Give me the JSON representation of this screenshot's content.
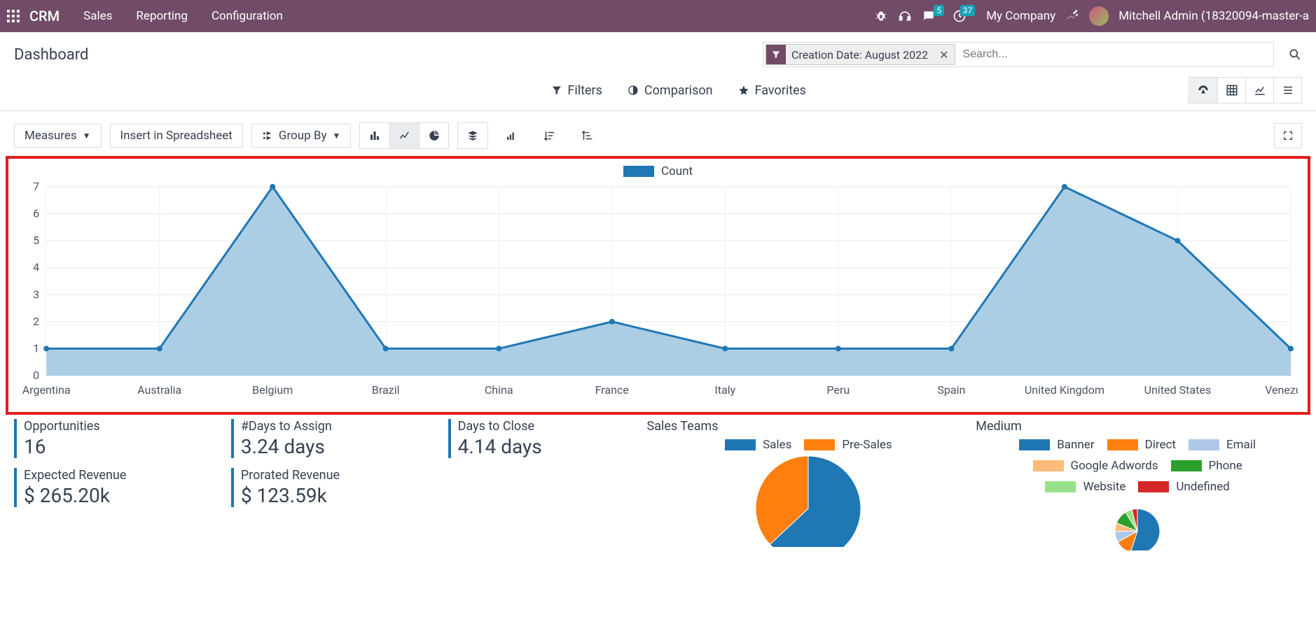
{
  "nav": {
    "brand": "CRM",
    "links": [
      "Sales",
      "Reporting",
      "Configuration"
    ],
    "company": "My Company",
    "username": "Mitchell Admin (18320094-master-a",
    "messages_badge": "5",
    "activities_badge": "37"
  },
  "header": {
    "title": "Dashboard",
    "chip_label": "Creation Date: August 2022",
    "search_placeholder": "Search..."
  },
  "filterbar": {
    "filters": "Filters",
    "comparison": "Comparison",
    "favorites": "Favorites"
  },
  "toolbar": {
    "measures": "Measures",
    "insert": "Insert in Spreadsheet",
    "groupby": "Group By"
  },
  "chart_data": {
    "type": "area",
    "series_name": "Count",
    "categories": [
      "Argentina",
      "Australia",
      "Belgium",
      "Brazil",
      "China",
      "France",
      "Italy",
      "Peru",
      "Spain",
      "United Kingdom",
      "United States",
      "Venezuela"
    ],
    "values": [
      1,
      1,
      7,
      1,
      1,
      2,
      1,
      1,
      1,
      7,
      5,
      1
    ],
    "ylim": [
      0,
      7
    ],
    "yticks": [
      0,
      1,
      2,
      3,
      4,
      5,
      6,
      7
    ],
    "xlabel": "",
    "ylabel": ""
  },
  "kpis": {
    "opportunities": {
      "label": "Opportunities",
      "value": "16"
    },
    "days_assign": {
      "label": "#Days to Assign",
      "value": "3.24 days"
    },
    "days_close": {
      "label": "Days to Close",
      "value": "4.14 days"
    },
    "expected_rev": {
      "label": "Expected Revenue",
      "value": "$ 265.20k"
    },
    "prorated_rev": {
      "label": "Prorated Revenue",
      "value": "$ 123.59k"
    }
  },
  "sales_teams": {
    "title": "Sales Teams",
    "legend": [
      {
        "name": "Sales",
        "color": "#1f77b4"
      },
      {
        "name": "Pre-Sales",
        "color": "#ff7f0e"
      }
    ],
    "slices": [
      {
        "name": "Sales",
        "value": 63,
        "color": "#1f77b4"
      },
      {
        "name": "Pre-Sales",
        "value": 37,
        "color": "#ff7f0e"
      }
    ]
  },
  "medium": {
    "title": "Medium",
    "legend": [
      {
        "name": "Banner",
        "color": "#1f77b4"
      },
      {
        "name": "Direct",
        "color": "#ff7f0e"
      },
      {
        "name": "Email",
        "color": "#aec7e8"
      },
      {
        "name": "Google Adwords",
        "color": "#ffbb78"
      },
      {
        "name": "Phone",
        "color": "#2ca02c"
      },
      {
        "name": "Website",
        "color": "#98df8a"
      },
      {
        "name": "Undefined",
        "color": "#d62728"
      }
    ],
    "slices": [
      {
        "name": "Banner",
        "value": 55,
        "color": "#1f77b4"
      },
      {
        "name": "Direct",
        "value": 12,
        "color": "#ff7f0e"
      },
      {
        "name": "Email",
        "value": 8,
        "color": "#aec7e8"
      },
      {
        "name": "Google Adwords",
        "value": 6,
        "color": "#ffbb78"
      },
      {
        "name": "Phone",
        "value": 10,
        "color": "#2ca02c"
      },
      {
        "name": "Website",
        "value": 5,
        "color": "#98df8a"
      },
      {
        "name": "Undefined",
        "value": 4,
        "color": "#d62728"
      }
    ]
  }
}
